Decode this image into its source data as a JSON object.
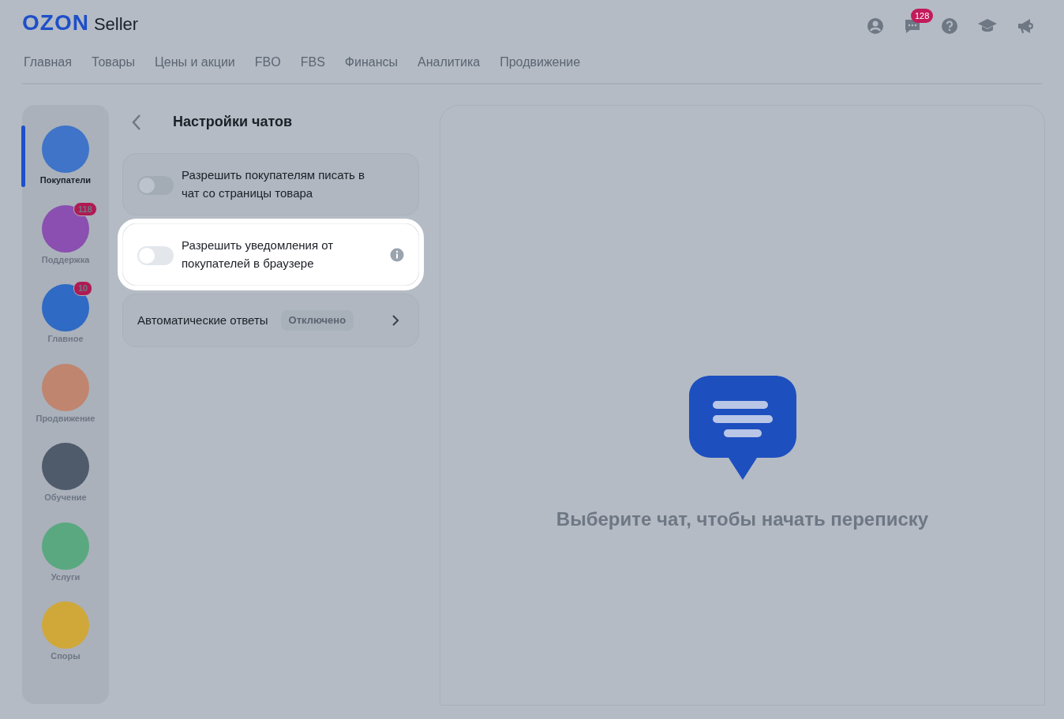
{
  "header": {
    "logo": "OZON",
    "logo_suffix": "Seller",
    "chat_badge": "128"
  },
  "nav": [
    {
      "label": "Главная"
    },
    {
      "label": "Товары"
    },
    {
      "label": "Цены и акции"
    },
    {
      "label": "FBO"
    },
    {
      "label": "FBS"
    },
    {
      "label": "Финансы"
    },
    {
      "label": "Аналитика"
    },
    {
      "label": "Продвижение"
    }
  ],
  "sidebar": {
    "items": [
      {
        "label": "Покупатели",
        "selected": true
      },
      {
        "label": "Поддержка",
        "selected": false,
        "badge": "118"
      },
      {
        "label": "Главное",
        "selected": false,
        "badge": "10"
      },
      {
        "label": "Продвижение",
        "selected": false
      },
      {
        "label": "Обучение",
        "selected": false
      },
      {
        "label": "Услуги",
        "selected": false
      },
      {
        "label": "Споры",
        "selected": false
      }
    ]
  },
  "settings": {
    "title": "Настройки чатов",
    "items": [
      {
        "kind": "toggle",
        "label": "Разрешить покупателям писать в чат со страницы товара",
        "on": false,
        "highlighted": false,
        "info": false
      },
      {
        "kind": "toggle",
        "label": "Разрешить уведомления от покупателей в браузере",
        "on": false,
        "highlighted": true,
        "info": true
      },
      {
        "kind": "link",
        "label": "Автоматические ответы",
        "status": "Отключено",
        "highlighted": false
      }
    ]
  },
  "empty_state": {
    "message": "Выберите чат, чтобы начать переписку"
  }
}
